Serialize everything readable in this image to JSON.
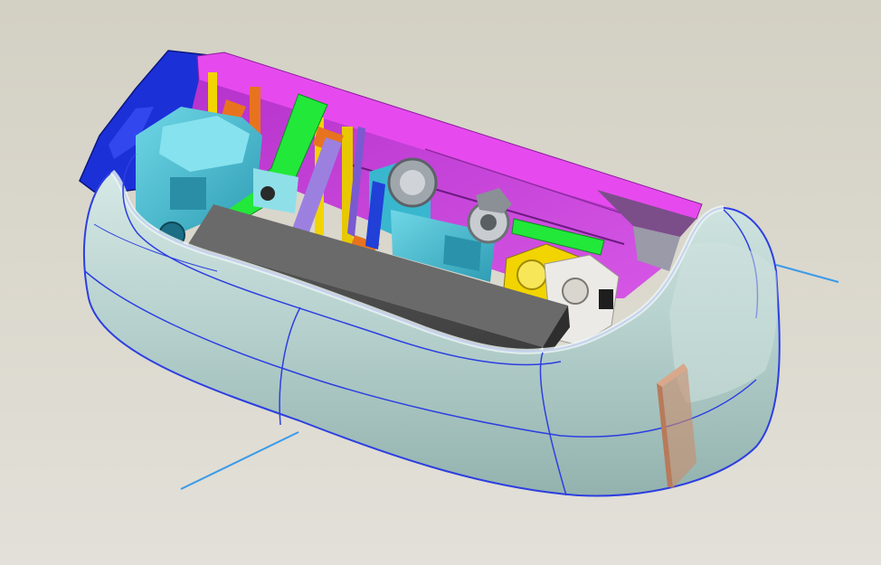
{
  "scene": {
    "kind": "3D CAD assembly view",
    "colors": {
      "background": "#d8d5ca",
      "shell": "#b9d3d0",
      "shell_edges": "#2d3fe0",
      "back_panel": "#c23bd6",
      "bracket": "#1a2ed4",
      "engine": "#3dbad0",
      "battery_box": "#4a4a4a",
      "green_part": "#22e83a",
      "yellow_part": "#f2d400",
      "orange_part": "#e8731f",
      "datum_axis": "#3a9ae8",
      "bumper": "#c98c6a"
    }
  }
}
